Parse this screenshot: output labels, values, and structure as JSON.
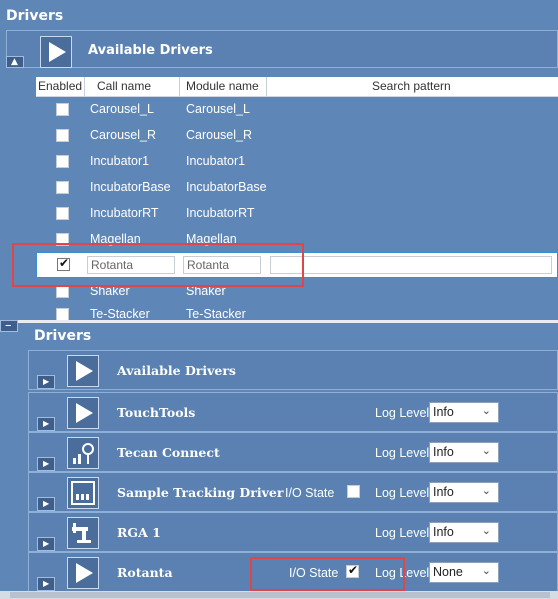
{
  "top": {
    "title": "Drivers",
    "available_title": "Available Drivers",
    "columns": {
      "enabled": "Enabled",
      "call_name": "Call name",
      "module_name": "Module name",
      "search_pattern": "Search pattern"
    },
    "rows": [
      {
        "call": "Carousel_L",
        "module": "Carousel_L"
      },
      {
        "call": "Carousel_R",
        "module": "Carousel_R"
      },
      {
        "call": "Incubator1",
        "module": "Incubator1"
      },
      {
        "call": "IncubatorBase",
        "module": "IncubatorBase"
      },
      {
        "call": "IncubatorRT",
        "module": "IncubatorRT"
      },
      {
        "call": "Magellan",
        "module": "Magellan"
      },
      {
        "call": "Shaker",
        "module": "Shaker"
      },
      {
        "call": "Te-Stacker",
        "module": "Te-Stacker"
      }
    ],
    "selected_row": {
      "call": "Rotanta",
      "module": "Rotanta",
      "enabled": true
    }
  },
  "bottom": {
    "title": "Drivers",
    "available_title": "Available Drivers",
    "log_level_label": "Log Level",
    "io_state_label": "I/O State",
    "drivers": [
      {
        "name": "TouchTools",
        "icon": "play-icon",
        "log_level": "Info"
      },
      {
        "name": "Tecan Connect",
        "icon": "tecan-connect-icon",
        "log_level": "Info"
      },
      {
        "name": "Sample Tracking Driver",
        "icon": "sample-tracking-icon",
        "log_level": "Info",
        "io_state": false
      },
      {
        "name": "RGA 1",
        "icon": "robot-arm-icon",
        "log_level": "Info"
      },
      {
        "name": "Rotanta",
        "icon": "play-icon",
        "log_level": "None",
        "io_state": true
      }
    ]
  },
  "colors": {
    "panel": "#5e86b7",
    "highlight": "#e0454a",
    "selection_border": "#3a8fd1"
  }
}
